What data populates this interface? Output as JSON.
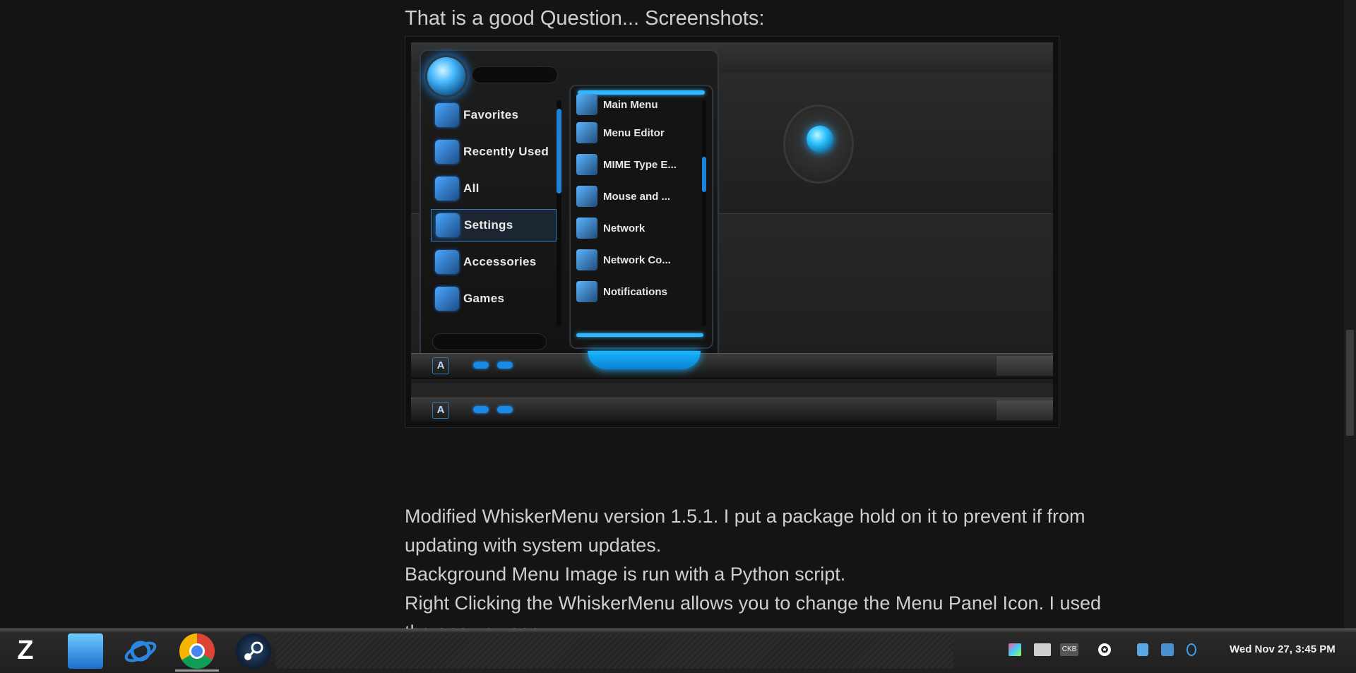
{
  "post": {
    "heading": "That is a good Question... Screenshots:",
    "paragraphs": [
      "Modified WhiskerMenu version 1.5.1. I put a package hold on it to prevent if from",
      "updating with system updates.",
      "Background Menu Image is run with a Python script.",
      "Right Clicking the WhiskerMenu allows you to change the Menu Panel Icon. I used",
      "the one you see."
    ]
  },
  "screenshot": {
    "categories": [
      "Favorites",
      "Recently Used",
      "All",
      "Settings",
      "Accessories",
      "Games"
    ],
    "active_category": "Settings",
    "apps": [
      "Main Menu",
      "Menu Editor",
      "MIME Type E...",
      "Mouse and ...",
      "Network",
      "Network Co...",
      "Notifications"
    ],
    "panel_letter": "A"
  },
  "taskbar": {
    "start_glyph": "Z",
    "apps": [
      "files-icon",
      "browser-icon",
      "chrome-icon",
      "steam-icon"
    ],
    "tray": {
      "ckb_label": "CKB",
      "a11y_glyph": "✪"
    },
    "clock": "Wed Nov 27,  3:45 PM"
  },
  "colors": {
    "accent": "#2fb8ff",
    "background": "#141414"
  }
}
